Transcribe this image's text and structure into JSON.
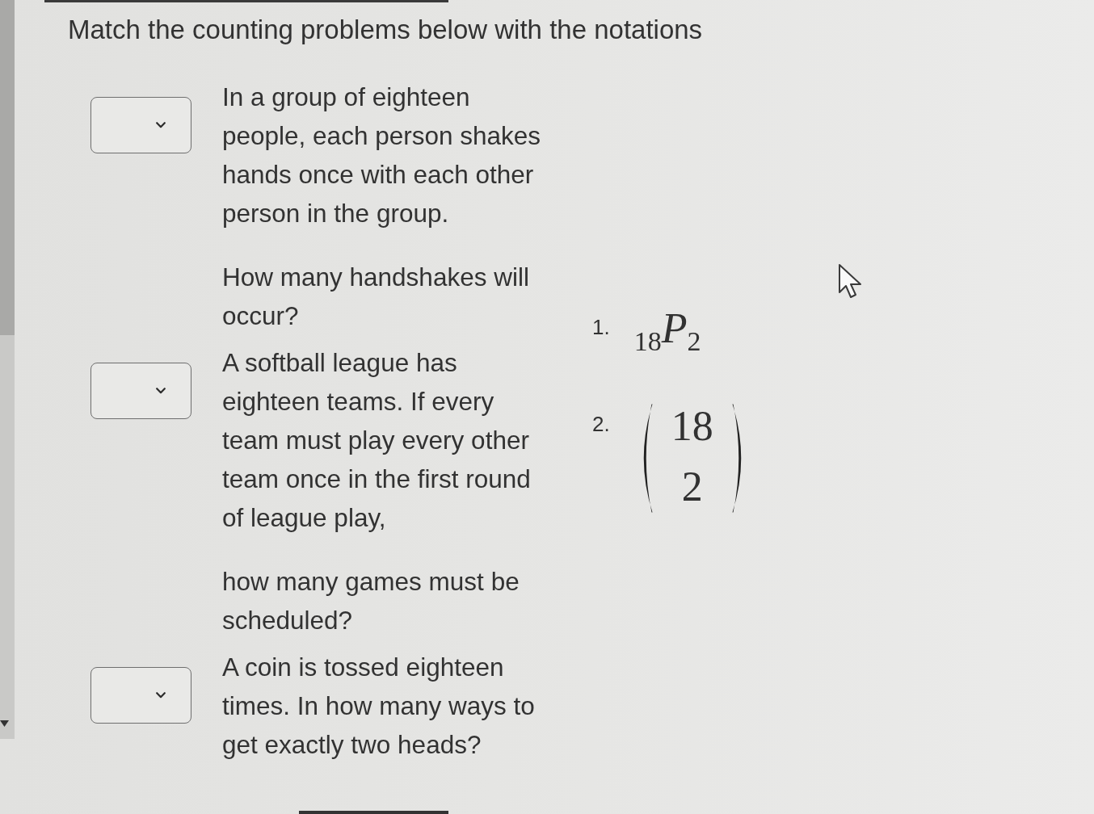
{
  "instruction": "Match the counting problems below with the notations",
  "problems": [
    {
      "paragraphs": [
        {
          "lines": [
            "In a group of eighteen",
            "people, each person shakes",
            "hands once with each other",
            "person in the group."
          ]
        },
        {
          "lines": [
            "How many handshakes will",
            "occur?"
          ]
        }
      ]
    },
    {
      "paragraphs": [
        {
          "lines": [
            "A softball league has",
            "eighteen teams. If every",
            "team must play every other",
            "team once in the first round",
            "of league play,"
          ]
        },
        {
          "lines": [
            "how many games must be",
            "scheduled?"
          ]
        }
      ]
    },
    {
      "paragraphs": [
        {
          "lines": [
            "A coin is tossed eighteen",
            "times. In how many ways to",
            "get exactly two heads?"
          ]
        }
      ]
    }
  ],
  "options": [
    {
      "number": "1.",
      "kind": "permutation",
      "n": "18",
      "symbol": "P",
      "k": "2"
    },
    {
      "number": "2.",
      "kind": "binomial",
      "n": "18",
      "k": "2"
    }
  ]
}
